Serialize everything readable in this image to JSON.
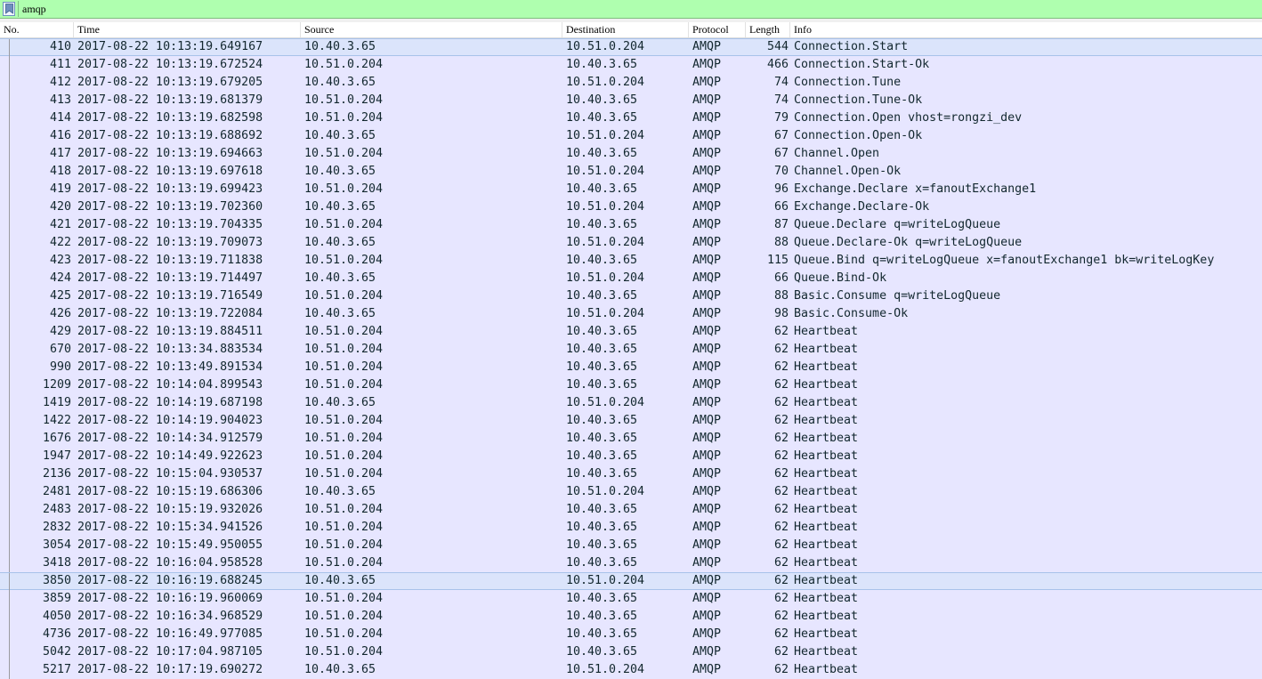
{
  "filter": {
    "value": "amqp"
  },
  "columns": {
    "no": "No.",
    "time": "Time",
    "source": "Source",
    "destination": "Destination",
    "protocol": "Protocol",
    "length": "Length",
    "info": "Info"
  },
  "colors": {
    "filter_bg": "#afffaf",
    "row_bg": "#e7e6ff",
    "row_text": "#12272e",
    "selected_bg": "#dbe4fb"
  },
  "selected_rows": [
    0,
    30
  ],
  "packets": [
    [
      "410",
      "2017-08-22 10:13:19.649167",
      "10.40.3.65",
      "10.51.0.204",
      "AMQP",
      "544",
      "Connection.Start"
    ],
    [
      "411",
      "2017-08-22 10:13:19.672524",
      "10.51.0.204",
      "10.40.3.65",
      "AMQP",
      "466",
      "Connection.Start-Ok"
    ],
    [
      "412",
      "2017-08-22 10:13:19.679205",
      "10.40.3.65",
      "10.51.0.204",
      "AMQP",
      "74",
      "Connection.Tune"
    ],
    [
      "413",
      "2017-08-22 10:13:19.681379",
      "10.51.0.204",
      "10.40.3.65",
      "AMQP",
      "74",
      "Connection.Tune-Ok"
    ],
    [
      "414",
      "2017-08-22 10:13:19.682598",
      "10.51.0.204",
      "10.40.3.65",
      "AMQP",
      "79",
      "Connection.Open vhost=rongzi_dev"
    ],
    [
      "416",
      "2017-08-22 10:13:19.688692",
      "10.40.3.65",
      "10.51.0.204",
      "AMQP",
      "67",
      "Connection.Open-Ok"
    ],
    [
      "417",
      "2017-08-22 10:13:19.694663",
      "10.51.0.204",
      "10.40.3.65",
      "AMQP",
      "67",
      "Channel.Open"
    ],
    [
      "418",
      "2017-08-22 10:13:19.697618",
      "10.40.3.65",
      "10.51.0.204",
      "AMQP",
      "70",
      "Channel.Open-Ok"
    ],
    [
      "419",
      "2017-08-22 10:13:19.699423",
      "10.51.0.204",
      "10.40.3.65",
      "AMQP",
      "96",
      "Exchange.Declare x=fanoutExchange1"
    ],
    [
      "420",
      "2017-08-22 10:13:19.702360",
      "10.40.3.65",
      "10.51.0.204",
      "AMQP",
      "66",
      "Exchange.Declare-Ok"
    ],
    [
      "421",
      "2017-08-22 10:13:19.704335",
      "10.51.0.204",
      "10.40.3.65",
      "AMQP",
      "87",
      "Queue.Declare q=writeLogQueue"
    ],
    [
      "422",
      "2017-08-22 10:13:19.709073",
      "10.40.3.65",
      "10.51.0.204",
      "AMQP",
      "88",
      "Queue.Declare-Ok q=writeLogQueue"
    ],
    [
      "423",
      "2017-08-22 10:13:19.711838",
      "10.51.0.204",
      "10.40.3.65",
      "AMQP",
      "115",
      "Queue.Bind q=writeLogQueue x=fanoutExchange1 bk=writeLogKey"
    ],
    [
      "424",
      "2017-08-22 10:13:19.714497",
      "10.40.3.65",
      "10.51.0.204",
      "AMQP",
      "66",
      "Queue.Bind-Ok"
    ],
    [
      "425",
      "2017-08-22 10:13:19.716549",
      "10.51.0.204",
      "10.40.3.65",
      "AMQP",
      "88",
      "Basic.Consume q=writeLogQueue"
    ],
    [
      "426",
      "2017-08-22 10:13:19.722084",
      "10.40.3.65",
      "10.51.0.204",
      "AMQP",
      "98",
      "Basic.Consume-Ok"
    ],
    [
      "429",
      "2017-08-22 10:13:19.884511",
      "10.51.0.204",
      "10.40.3.65",
      "AMQP",
      "62",
      "Heartbeat"
    ],
    [
      "670",
      "2017-08-22 10:13:34.883534",
      "10.51.0.204",
      "10.40.3.65",
      "AMQP",
      "62",
      "Heartbeat"
    ],
    [
      "990",
      "2017-08-22 10:13:49.891534",
      "10.51.0.204",
      "10.40.3.65",
      "AMQP",
      "62",
      "Heartbeat"
    ],
    [
      "1209",
      "2017-08-22 10:14:04.899543",
      "10.51.0.204",
      "10.40.3.65",
      "AMQP",
      "62",
      "Heartbeat"
    ],
    [
      "1419",
      "2017-08-22 10:14:19.687198",
      "10.40.3.65",
      "10.51.0.204",
      "AMQP",
      "62",
      "Heartbeat"
    ],
    [
      "1422",
      "2017-08-22 10:14:19.904023",
      "10.51.0.204",
      "10.40.3.65",
      "AMQP",
      "62",
      "Heartbeat"
    ],
    [
      "1676",
      "2017-08-22 10:14:34.912579",
      "10.51.0.204",
      "10.40.3.65",
      "AMQP",
      "62",
      "Heartbeat"
    ],
    [
      "1947",
      "2017-08-22 10:14:49.922623",
      "10.51.0.204",
      "10.40.3.65",
      "AMQP",
      "62",
      "Heartbeat"
    ],
    [
      "2136",
      "2017-08-22 10:15:04.930537",
      "10.51.0.204",
      "10.40.3.65",
      "AMQP",
      "62",
      "Heartbeat"
    ],
    [
      "2481",
      "2017-08-22 10:15:19.686306",
      "10.40.3.65",
      "10.51.0.204",
      "AMQP",
      "62",
      "Heartbeat"
    ],
    [
      "2483",
      "2017-08-22 10:15:19.932026",
      "10.51.0.204",
      "10.40.3.65",
      "AMQP",
      "62",
      "Heartbeat"
    ],
    [
      "2832",
      "2017-08-22 10:15:34.941526",
      "10.51.0.204",
      "10.40.3.65",
      "AMQP",
      "62",
      "Heartbeat"
    ],
    [
      "3054",
      "2017-08-22 10:15:49.950055",
      "10.51.0.204",
      "10.40.3.65",
      "AMQP",
      "62",
      "Heartbeat"
    ],
    [
      "3418",
      "2017-08-22 10:16:04.958528",
      "10.51.0.204",
      "10.40.3.65",
      "AMQP",
      "62",
      "Heartbeat"
    ],
    [
      "3850",
      "2017-08-22 10:16:19.688245",
      "10.40.3.65",
      "10.51.0.204",
      "AMQP",
      "62",
      "Heartbeat"
    ],
    [
      "3859",
      "2017-08-22 10:16:19.960069",
      "10.51.0.204",
      "10.40.3.65",
      "AMQP",
      "62",
      "Heartbeat"
    ],
    [
      "4050",
      "2017-08-22 10:16:34.968529",
      "10.51.0.204",
      "10.40.3.65",
      "AMQP",
      "62",
      "Heartbeat"
    ],
    [
      "4736",
      "2017-08-22 10:16:49.977085",
      "10.51.0.204",
      "10.40.3.65",
      "AMQP",
      "62",
      "Heartbeat"
    ],
    [
      "5042",
      "2017-08-22 10:17:04.987105",
      "10.51.0.204",
      "10.40.3.65",
      "AMQP",
      "62",
      "Heartbeat"
    ],
    [
      "5217",
      "2017-08-22 10:17:19.690272",
      "10.40.3.65",
      "10.51.0.204",
      "AMQP",
      "62",
      "Heartbeat"
    ]
  ]
}
